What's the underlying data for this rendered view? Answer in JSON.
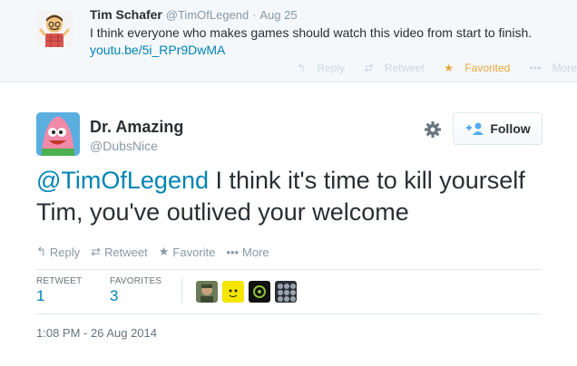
{
  "parent_tweet": {
    "author_name": "Tim Schafer",
    "author_handle": "@TimOfLegend",
    "separator": "·",
    "date": "Aug 25",
    "text": "I think everyone who makes games should watch this video from start to finish.",
    "link": "youtu.be/5i_RPr9DwMA",
    "actions": {
      "reply": "Reply",
      "retweet": "Retweet",
      "favorited": "Favorited",
      "more": "More"
    }
  },
  "tweet": {
    "author_name": "Dr. Amazing",
    "author_handle": "@DubsNice",
    "follow_label": "Follow",
    "mention": "@TimOfLegend",
    "text": " I think it's time to kill yourself Tim, you've outlived your welcome",
    "actions": {
      "reply": "Reply",
      "retweet": "Retweet",
      "favorite": "Favorite",
      "more": "More"
    },
    "stats": {
      "retweet_label": "RETWEET",
      "retweet_count": "1",
      "favorites_label": "FAVORITES",
      "favorites_count": "3"
    },
    "timestamp": "1:08 PM - 26 Aug 2014"
  },
  "colors": {
    "link": "#0084b4",
    "favorited": "#e8a63b",
    "muted": "#8899a6",
    "text": "#292f33"
  },
  "icons": {
    "reply": "reply-icon",
    "retweet": "retweet-icon",
    "favorite": "star-icon",
    "more": "more-dots-icon",
    "settings": "gear-icon",
    "follow": "add-user-icon"
  }
}
